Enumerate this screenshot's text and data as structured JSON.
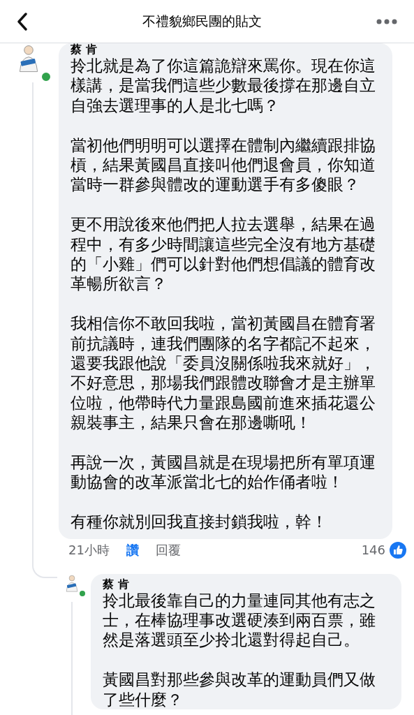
{
  "header": {
    "title": "不禮貌鄉民團的貼文"
  },
  "comments": [
    {
      "author": "蔡 肯",
      "online": true,
      "paragraphs": [
        "拎北就是為了你這篇詭辯來罵你。現在你這樣講，是當我們這些少數最後撐在那邊自立自強去選理事的人是北七嗎？",
        "當初他們明明可以選擇在體制內繼續跟排協槓，結果黃國昌直接叫他們退會員，你知道當時一群參與體改的運動選手有多傻眼？",
        "更不用說後來他們把人拉去選舉，結果在過程中，有多少時間讓這些完全沒有地方基礎的「小雞」們可以針對他們想倡議的體育改革暢所欲言？",
        "我相信你不敢回我啦，當初黃國昌在體育署前抗議時，連我們團隊的名字都記不起來，還要我跟他說「委員沒關係啦我來就好」，不好意思，那場我們跟體改聯會才是主辦單位啦，他帶時代力量跟島國前進來插花還公親裝事主，結果只會在那邊嘶吼！",
        "再說一次，黃國昌就是在現場把所有單項運動協會的改革派當北七的始作俑者啦！",
        "有種你就別回我直接封鎖我啦，幹！"
      ],
      "time": "21小時",
      "like_label": "讚",
      "liked": true,
      "reply_label": "回覆",
      "likes": "146"
    },
    {
      "author": "蔡 肯",
      "online": true,
      "paragraphs": [
        "拎北最後靠自己的力量連同其他有志之士，在棒協理事改選硬湊到兩百票，雖然是落選頭至少拎北還對得起自己。",
        "黃國昌對那些參與改革的運動員們又做了些什麼？"
      ]
    }
  ]
}
